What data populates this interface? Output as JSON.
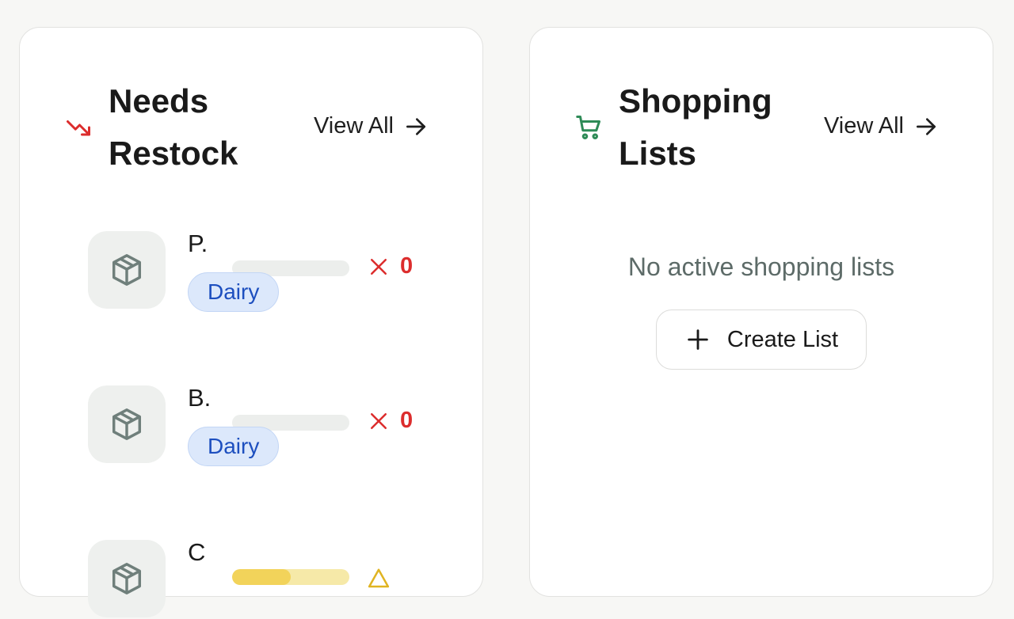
{
  "restock": {
    "title": "Needs Restock",
    "view_all": "View All",
    "items": [
      {
        "name": "P.",
        "category": "Dairy",
        "quantity": "0",
        "stock_level": 0,
        "status_icon": "x-icon"
      },
      {
        "name": "B.",
        "category": "Dairy",
        "quantity": "0",
        "stock_level": 0,
        "status_icon": "x-icon"
      },
      {
        "name": "C",
        "category": "",
        "quantity": "",
        "stock_level": 0.5,
        "status_icon": "warning-icon"
      }
    ]
  },
  "shopping": {
    "title": "Shopping Lists",
    "view_all": "View All",
    "empty_text": "No active shopping lists",
    "create_label": "Create List"
  },
  "colors": {
    "restock_accent": "#dc2d2d",
    "shopping_accent": "#2e8b57",
    "badge_text": "#1d4fbf",
    "badge_bg": "#dce8fb",
    "warning": "#f2d35a"
  }
}
